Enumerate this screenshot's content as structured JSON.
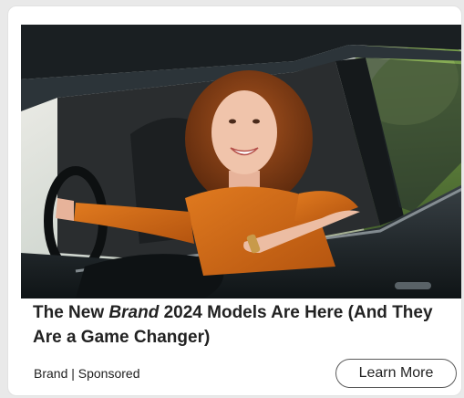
{
  "ad": {
    "headline": {
      "before": "The New ",
      "brand": "Brand",
      "after": " 2024 Models Are Here (And They Are a Game Changer)"
    },
    "sponsor_line": "Brand | Sponsored",
    "cta_label": "Learn More"
  },
  "colors": {
    "card_bg": "#ffffff",
    "page_bg": "#e9e9e9",
    "text": "#222222",
    "button_border": "#5a5a5a"
  }
}
